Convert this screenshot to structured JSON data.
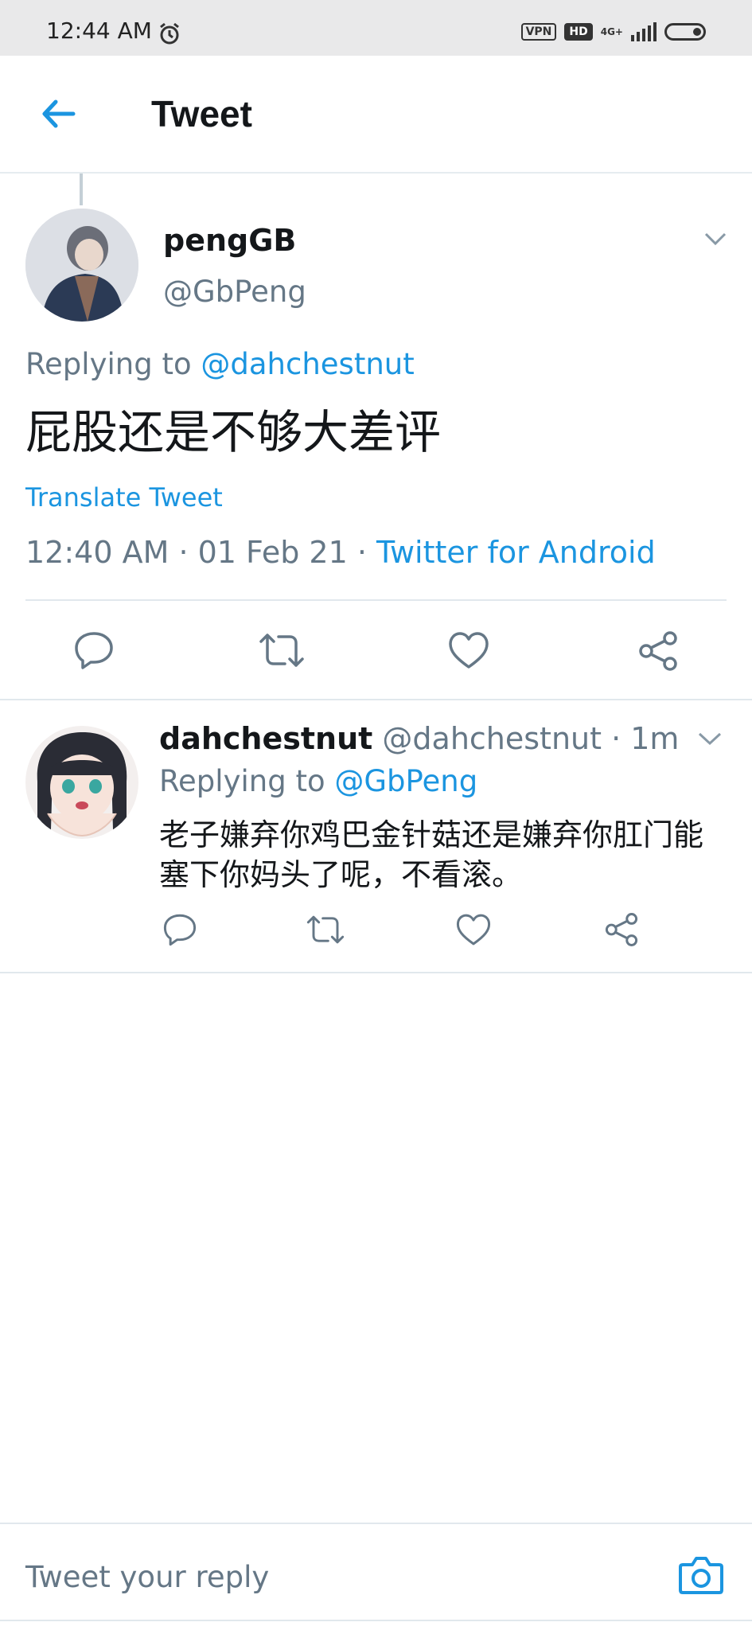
{
  "status_bar": {
    "time": "12:44 AM",
    "vpn": "VPN",
    "hd": "HD",
    "network": "4G+"
  },
  "header": {
    "title": "Tweet"
  },
  "main_tweet": {
    "display_name": "pengGB",
    "handle": "@GbPeng",
    "replying_prefix": "Replying to",
    "replying_to": "@dahchestnut",
    "text": "屁股还是不够大差评",
    "translate": "Translate Tweet",
    "timestamp": "12:40 AM · 01 Feb 21 ·",
    "source": "Twitter for Android"
  },
  "reply_tweet": {
    "display_name": "dahchestnut",
    "handle_time": "@dahchestnut · 1m",
    "replying_prefix": "Replying to",
    "replying_to": "@GbPeng",
    "text_line1": "老子嫌弃你鸡巴金针菇还是嫌弃你肛门能",
    "text_line2": "塞下你妈头了呢，不看滚。"
  },
  "composer": {
    "placeholder": "Tweet your reply"
  },
  "colors": {
    "accent": "#1b95e0",
    "muted": "#657786",
    "divider": "#e1e8ed"
  },
  "icons": [
    "back-arrow-icon",
    "alarm-icon",
    "chevron-down-icon",
    "reply-icon",
    "retweet-icon",
    "like-icon",
    "share-icon",
    "camera-icon"
  ]
}
